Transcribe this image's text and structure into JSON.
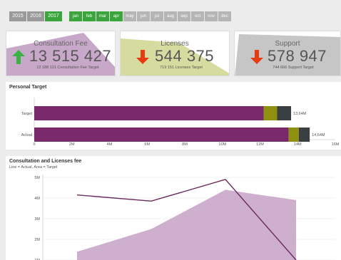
{
  "filters": {
    "years": [
      {
        "label": "2015",
        "selected": false
      },
      {
        "label": "2016",
        "selected": false
      },
      {
        "label": "2017",
        "selected": true
      }
    ],
    "months": [
      {
        "label": "jan",
        "selected": true
      },
      {
        "label": "feb",
        "selected": true
      },
      {
        "label": "mar",
        "selected": true
      },
      {
        "label": "apr",
        "selected": true
      },
      {
        "label": "may",
        "selected": false
      },
      {
        "label": "jun",
        "selected": false
      },
      {
        "label": "jul",
        "selected": false
      },
      {
        "label": "aug",
        "selected": false
      },
      {
        "label": "sep",
        "selected": false
      },
      {
        "label": "oct",
        "selected": false
      },
      {
        "label": "nov",
        "selected": false
      },
      {
        "label": "dec",
        "selected": false
      }
    ]
  },
  "kpis": {
    "consultation": {
      "title": "Consultation Fee",
      "value": "13 515 427",
      "target": "12 188 121 Consultation Fee Target",
      "trend": "up",
      "icon": "arrow-up-icon",
      "color": "#3cb043",
      "shape_color": "#c8a8c8"
    },
    "licenses": {
      "title": "Licenses",
      "value": "544 375",
      "target": "719 151 Licenses Target",
      "trend": "down",
      "icon": "arrow-down-icon",
      "color": "#e83a10",
      "shape_color": "#d6dba0"
    },
    "support": {
      "title": "Support",
      "value": "578 947",
      "target": "744 666 Support Target",
      "trend": "down",
      "icon": "arrow-down-icon",
      "color": "#e83a10",
      "shape_color": "#c6c6c6"
    }
  },
  "colors": {
    "purple": "#7a2a6a",
    "olive": "#8f8f10",
    "dark": "#3a3f42",
    "area": "#c9a6c9",
    "line": "#6b2a5c"
  },
  "chart_data": [
    {
      "type": "bar",
      "title": "Personal Target",
      "orientation": "horizontal",
      "stacked": true,
      "categories": [
        "Target",
        "Actual"
      ],
      "series": [
        {
          "name": "Consultation Fee",
          "values": [
            12.19,
            13.52
          ],
          "color": "#7a2a6a"
        },
        {
          "name": "Licenses",
          "values": [
            0.72,
            0.54
          ],
          "color": "#8f8f10"
        },
        {
          "name": "Support",
          "values": [
            0.74,
            0.58
          ],
          "color": "#3a3f42"
        }
      ],
      "value_labels": [
        "13,64M",
        "14,64M"
      ],
      "xticks": [
        "0",
        "2M",
        "4M",
        "6M",
        "8M",
        "10M",
        "12M",
        "14M",
        "16M"
      ],
      "xlim": [
        0,
        16
      ]
    },
    {
      "type": "line",
      "title": "Consultation and Licenses fee",
      "subtitle": "Line = Actual, Area = Target",
      "yticks": [
        "1M",
        "2M",
        "3M",
        "4M",
        "5M"
      ],
      "ylim": [
        1,
        5
      ],
      "x": [
        1,
        2,
        3,
        4
      ],
      "series": [
        {
          "kind": "line",
          "values": [
            4.15,
            3.85,
            4.9,
            1.0
          ],
          "color": "#6b2a5c"
        },
        {
          "kind": "area",
          "values": [
            1.4,
            2.5,
            4.4,
            3.9
          ],
          "color": "#c9a6c9"
        }
      ]
    }
  ]
}
